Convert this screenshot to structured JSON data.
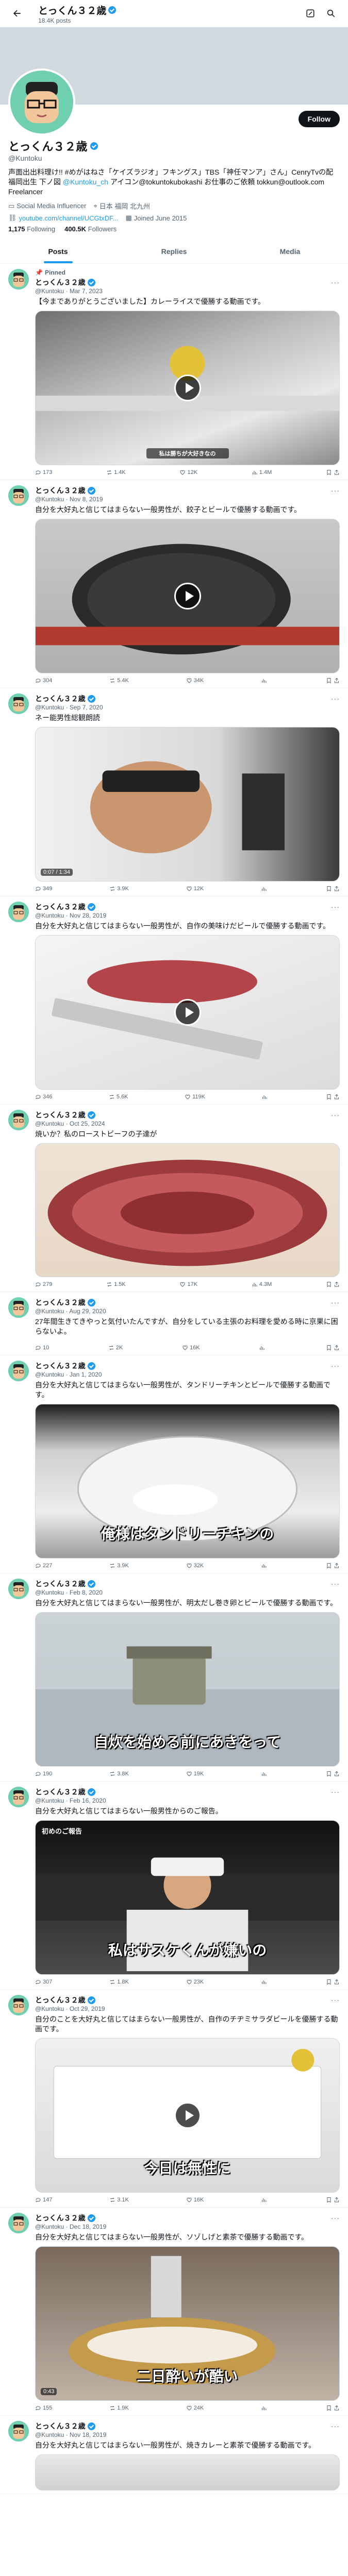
{
  "header": {
    "name": "とっくん３２歳",
    "post_count": "18.4K posts"
  },
  "profile": {
    "follow_label": "Follow",
    "name": "とっくん３２歳",
    "handle": "@Kuntoku",
    "bio_part1": "声面出出料理け!! #めがはねさ「ケイズラジオ」フキングス」TBS「神任マンア」さん」CenryTvの配 福岡出生 下ノ図",
    "bio_link": "@Kuntoku_ch",
    "bio_part2": "アイコン@tokuntokubokashi お仕事のご依頼 tokkun@outlook.com",
    "bio_tail": "Freelancer",
    "category": "Social Media Influencer",
    "location": "日本 福岡 北九州",
    "url": "youtube.com/channel/UCGtxDF...",
    "joined": "Joined June 2015",
    "following_count": "1,175",
    "following_label": "Following",
    "followers_count": "400.5K",
    "followers_label": "Followers"
  },
  "tabs": [
    "Posts",
    "Replies",
    "Media"
  ],
  "pinned_label": "Pinned",
  "tweets": [
    {
      "name": "とっくん３２歳",
      "handle": "@Kuntoku",
      "date": "Mar 7, 2023",
      "text": "【今までありがとうございました】カレーライスで優勝する動画です。",
      "caption": "私は勝ちが大好きなの",
      "replies": "173",
      "reposts": "1.4K",
      "likes": "12K",
      "views": "1.4M"
    },
    {
      "name": "とっくん３２歳",
      "handle": "@Kuntoku",
      "date": "Nov 8, 2019",
      "text": "自分を大好丸と信じてはまらない一般男性が、餃子とビールで優勝する動画です。",
      "caption": "",
      "replies": "304",
      "reposts": "5.4K",
      "likes": "34K",
      "views": ""
    },
    {
      "name": "とっくん３２歳",
      "handle": "@Kuntoku",
      "date": "Sep 7, 2020",
      "text": "ネー能男性総観朗読",
      "caption": "",
      "duration": "0:07 / 1:34",
      "replies": "349",
      "reposts": "3.9K",
      "likes": "12K",
      "views": ""
    },
    {
      "name": "とっくん３２歳",
      "handle": "@Kuntoku",
      "date": "Nov 28, 2019",
      "text": "自分を大好丸と信じてはまらない一般男性が、自作の美味けだビールで優勝する動画です。",
      "caption": "",
      "replies": "346",
      "reposts": "5.6K",
      "likes": "119K",
      "views": ""
    },
    {
      "name": "とっくん３２歳",
      "handle": "@Kuntoku",
      "date": "Oct 25, 2024",
      "text": "焼いか？私のローストビーフの子達が",
      "caption": "",
      "replies": "279",
      "reposts": "1.5K",
      "likes": "17K",
      "views": "4.3M"
    },
    {
      "name": "とっくん３２歳",
      "handle": "@Kuntoku",
      "date": "Aug 29, 2020",
      "text": "27年間生きてきやっと気付いたんですが、自分をしている主張のお料理を愛める時に京果に困らないよ。",
      "caption": "",
      "replies": "10",
      "reposts": "2K",
      "likes": "16K",
      "views": ""
    },
    {
      "name": "とっくん３２歳",
      "handle": "@Kuntoku",
      "date": "Jan 1, 2020",
      "text": "自分を大好丸と信じてはまらない一般男性が、タンドリーチキンとビールで優勝する動画です。",
      "caption": "俺様はタンドリーチキンの",
      "replies": "227",
      "reposts": "3.9K",
      "likes": "32K",
      "views": ""
    },
    {
      "name": "とっくん３２歳",
      "handle": "@Kuntoku",
      "date": "Feb 8, 2020",
      "text": "自分を大好丸と信じてはまらない一般男性が、明太だし巻き卵とビールで優勝する動画です。",
      "caption": "自炊を始める前にあきをって",
      "replies": "190",
      "reposts": "3.8K",
      "likes": "19K",
      "views": ""
    },
    {
      "name": "とっくん３２歳",
      "handle": "@Kuntoku",
      "date": "Feb 16, 2020",
      "text": "自分を大好丸と信じてはまらない一般男性からのご報告。",
      "label": "初めのご報告",
      "caption": "私はサスケくんが嫌いの",
      "replies": "307",
      "reposts": "1.8K",
      "likes": "23K",
      "views": ""
    },
    {
      "name": "とっくん３２歳",
      "handle": "@Kuntoku",
      "date": "Oct 29, 2019",
      "text": "自分のことを大好丸と信じてはまらない一般男性が、自作のチヂミサラダビールを優勝する動画です。",
      "caption": "今日は無性に",
      "replies": "147",
      "reposts": "3.1K",
      "likes": "16K",
      "views": ""
    },
    {
      "name": "とっくん３２歳",
      "handle": "@Kuntoku",
      "date": "Dec 18, 2019",
      "text": "自分を大好丸と信じてはまらない一般男性が、ソゾしげと素茶で優勝する動画です。",
      "caption": "二日酔いが酷い",
      "duration": "0:43",
      "replies": "155",
      "reposts": "1.9K",
      "likes": "24K",
      "views": ""
    },
    {
      "name": "とっくん３２歳",
      "handle": "@Kuntoku",
      "date": "Nov 18, 2019",
      "text": "自分を大好丸と信じてはまらない一般男性が、焼きカレーと素茶で優勝する動画です。",
      "caption": "",
      "replies": "",
      "reposts": "",
      "likes": "",
      "views": ""
    }
  ]
}
